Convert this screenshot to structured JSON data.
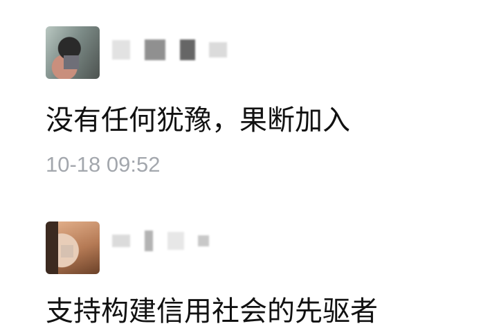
{
  "comments": [
    {
      "author": "",
      "text": "没有任何犹豫，果断加入",
      "timestamp": "10-18 09:52"
    },
    {
      "author": "",
      "text": "支持构建信用社会的先驱者"
    }
  ]
}
